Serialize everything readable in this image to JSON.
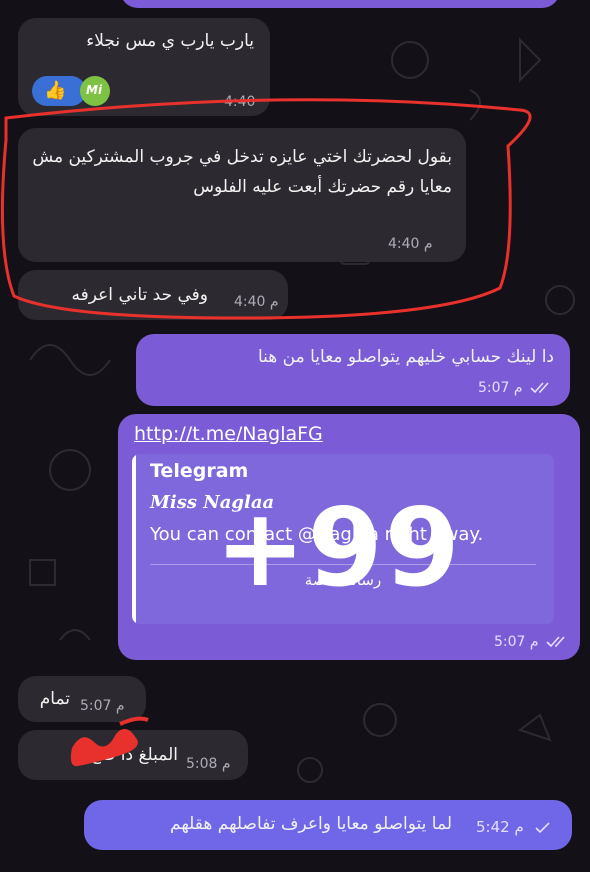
{
  "messages": [
    {
      "text": "يارب يارب ي مس نجلاء",
      "time": "4:40",
      "reactions": [
        "👍",
        "Mi"
      ]
    },
    {
      "text": "بقول لحضرتك اختي عايزه تدخل في جروب المشتركين مش معايا رقم حضرتك أبعت عليه الفلوس",
      "time": "4:40",
      "suffix": "م"
    },
    {
      "text": "وفي حد تاني اعرفه",
      "time": "4:40",
      "suffix": "م"
    },
    {
      "text": "دا لينك حسابي خليهم يتواصلو معايا من هنا",
      "time": "5:07",
      "suffix": "م"
    },
    {
      "link": "http://t.me/NaglaFG",
      "preview_site": "Telegram",
      "preview_title": "Miss Naglaa",
      "preview_desc": "You can contact @Naglaa right away.",
      "preview_button": "رسالة خاصة",
      "time": "5:07",
      "suffix": "م"
    },
    {
      "text": "تمام",
      "time": "5:07",
      "suffix": "م"
    },
    {
      "text": "المبلغ دا صح",
      "time": "5:08",
      "suffix": "م"
    },
    {
      "text": "لما يتواصلو معايا واعرف تفاصلهم هقلهم",
      "time": "5:42",
      "suffix": "م"
    }
  ],
  "overlay_text": "+99",
  "colors": {
    "incoming": "#2c2a30",
    "outgoing": "#7b5cd6",
    "annotation_red": "#e8312c"
  }
}
